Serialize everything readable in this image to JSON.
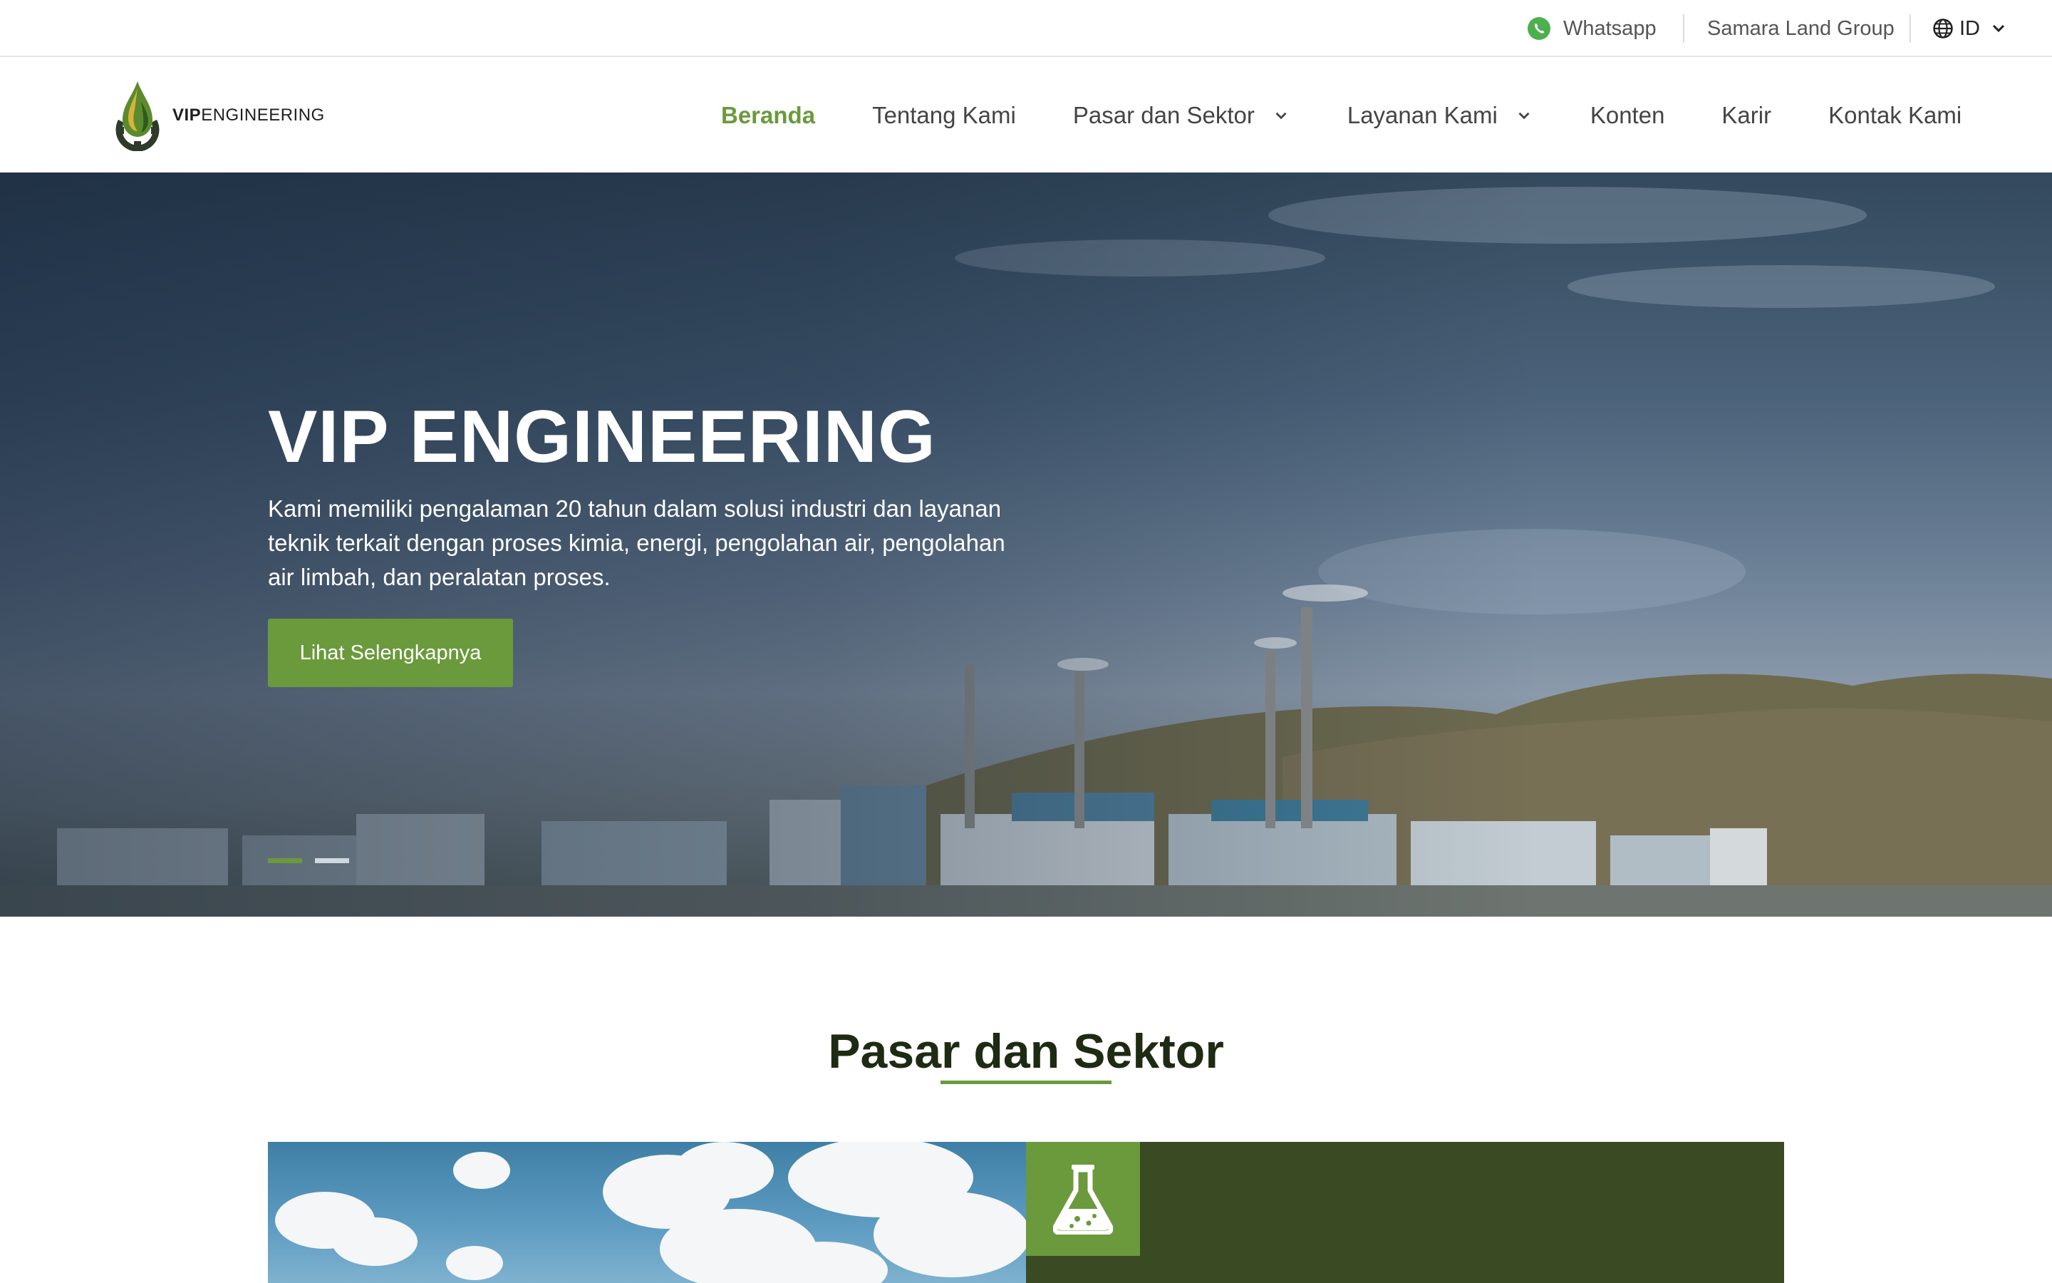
{
  "topbar": {
    "whatsapp_label": "Whatsapp",
    "group_label": "Samara Land Group",
    "language": "ID"
  },
  "brand": {
    "name_bold": "VIP",
    "name_rest": "ENGINEERING",
    "accent_color": "#6a9a3c"
  },
  "nav": {
    "items": [
      {
        "label": "Beranda",
        "active": true
      },
      {
        "label": "Tentang Kami"
      },
      {
        "label": "Pasar dan Sektor",
        "dropdown": true
      },
      {
        "label": "Layanan Kami",
        "dropdown": true
      },
      {
        "label": "Konten"
      },
      {
        "label": "Karir"
      },
      {
        "label": "Kontak Kami"
      }
    ]
  },
  "hero": {
    "title": "VIP ENGINEERING",
    "text": "Kami memiliki pengalaman 20 tahun dalam solusi industri dan layanan teknik terkait dengan proses kimia, energi, pengolahan air, pengolahan air limbah, dan peralatan proses.",
    "button_label": "Lihat Selengkapnya",
    "slides": 2,
    "active_slide": 1
  },
  "section": {
    "title": "Pasar dan Sektor",
    "card_icon": "flask-icon"
  }
}
